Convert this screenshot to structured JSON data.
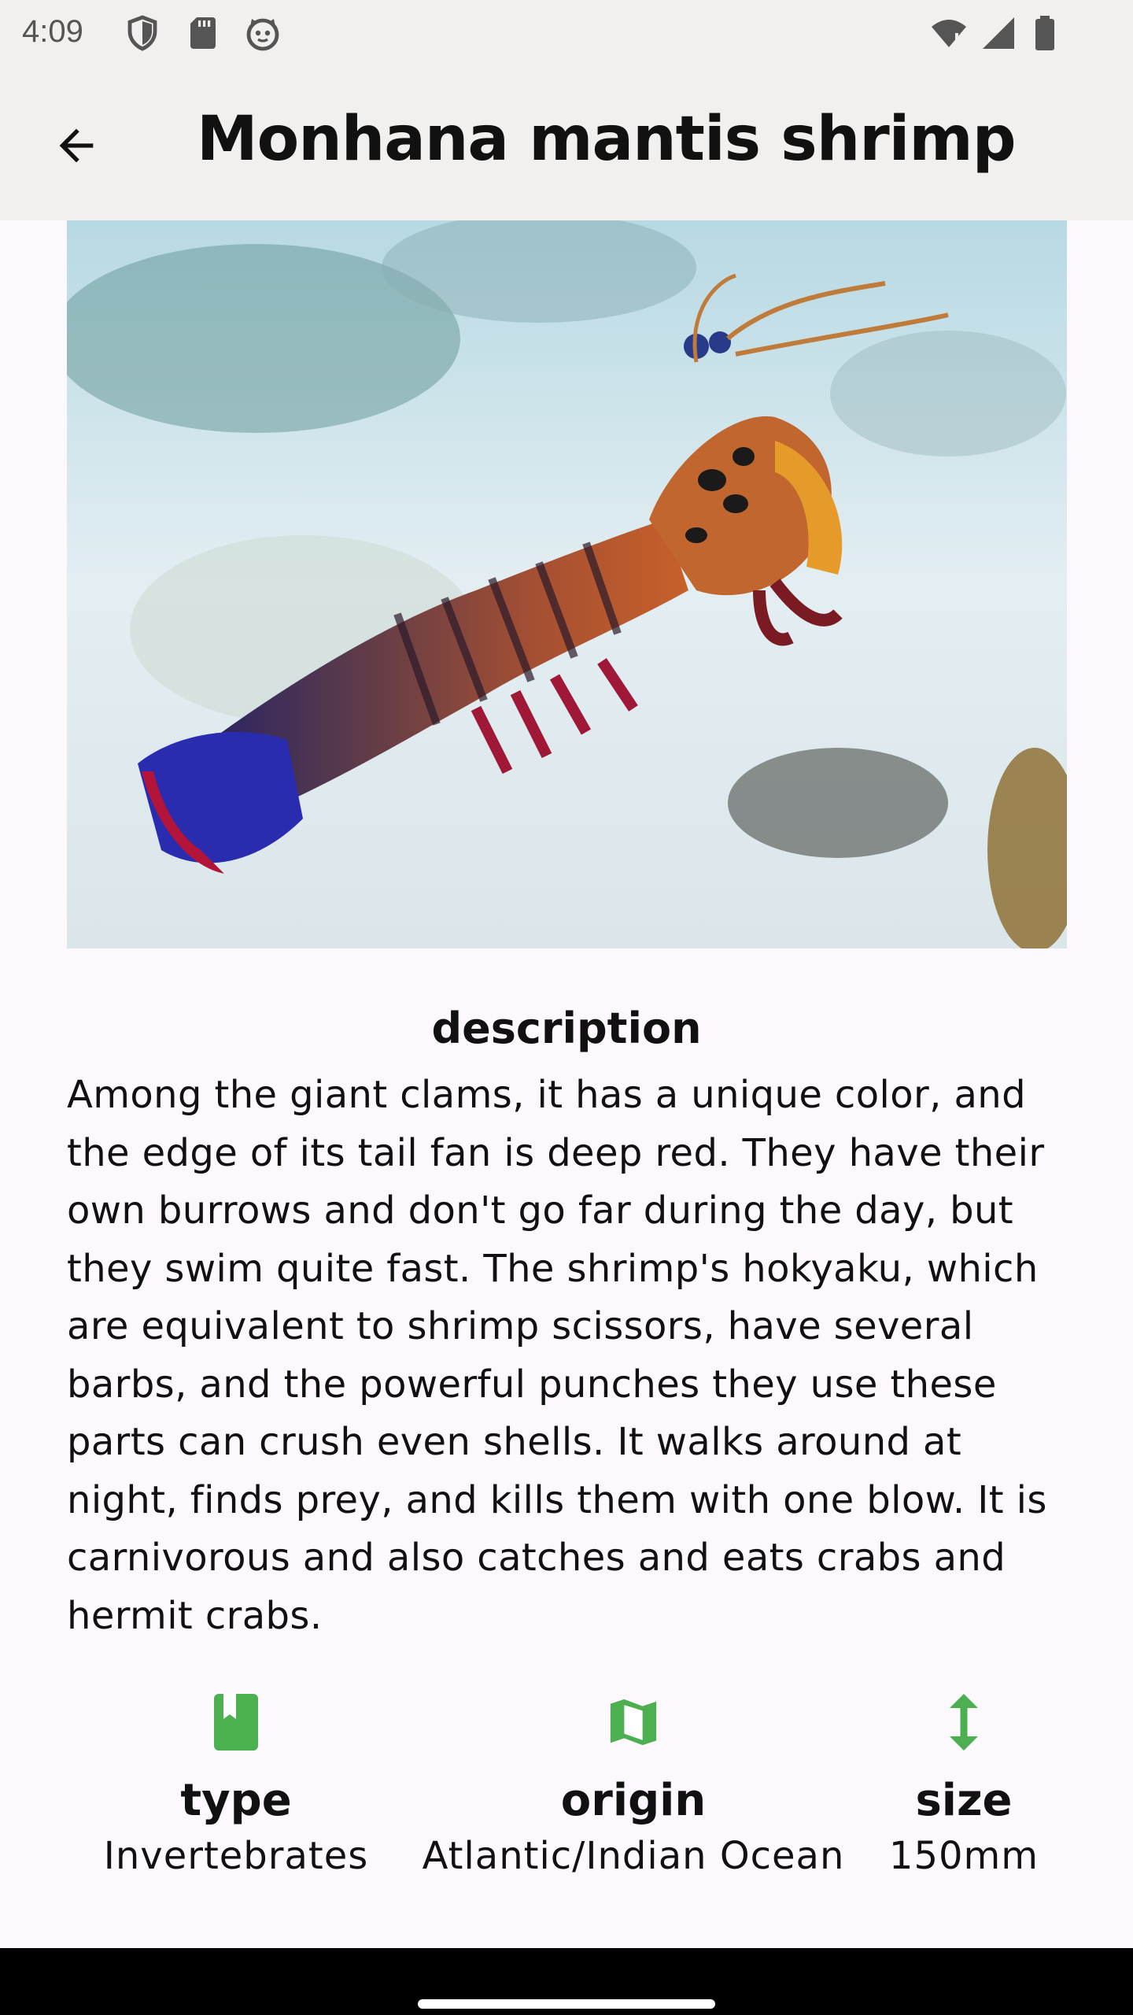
{
  "status_bar": {
    "time": "4:09",
    "left_icons": [
      "shield-icon",
      "sd-card-icon",
      "cat-face-icon"
    ],
    "right_icons": [
      "wifi-icon",
      "signal-icon",
      "battery-icon"
    ]
  },
  "app_bar": {
    "title": "Monhana mantis shrimp",
    "back_icon": "arrow-back-icon"
  },
  "photo": {
    "subject": "mantis shrimp on sandy seabed"
  },
  "description": {
    "heading": "description",
    "text": "Among the giant clams, it has a unique color, and the edge of its tail fan is deep red. They have their own burrows and don't go far during the day, but they swim quite fast. The shrimp's hokyaku, which are equivalent to shrimp scissors, have several barbs, and the powerful punches they use these parts can crush even shells. It walks around at night, finds prey, and kills them with one blow. It is carnivorous and also catches and eats crabs and hermit crabs."
  },
  "info": {
    "accent_color": "#4caf50",
    "type": {
      "label": "type",
      "value": "Invertebrates",
      "icon": "book-icon"
    },
    "origin": {
      "label": "origin",
      "value": "Atlantic/Indian Ocean",
      "icon": "map-icon"
    },
    "size": {
      "label": "size",
      "value": "150mm",
      "icon": "height-arrows-icon"
    }
  }
}
